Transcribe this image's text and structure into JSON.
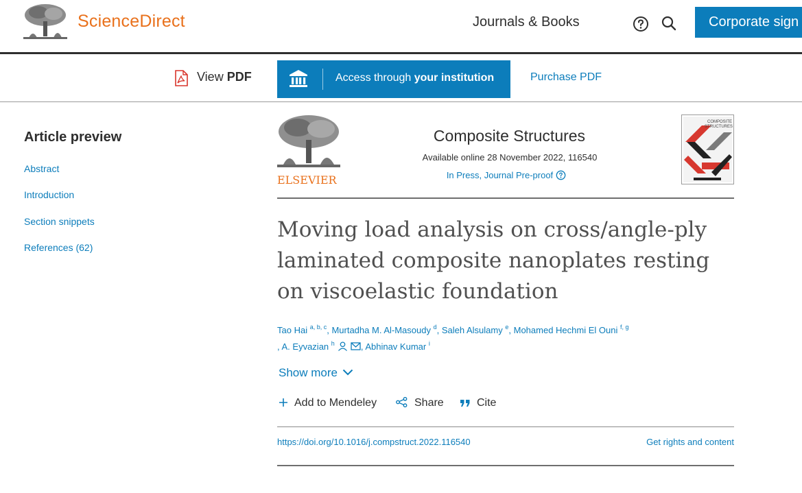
{
  "header": {
    "brand": "ScienceDirect",
    "nav_journals": "Journals & Books",
    "help_icon": "question-circle-icon",
    "search_icon": "search-icon",
    "corporate_button": "Corporate sign in",
    "brand_color": "#e9711c",
    "accent_color": "#0c7dbb"
  },
  "action_bar": {
    "view_pdf_prefix": "View",
    "view_pdf_bold": "PDF",
    "access_prefix": "Access through",
    "access_bold": "your institution",
    "purchase_pdf": "Purchase PDF"
  },
  "sidebar": {
    "title": "Article preview",
    "items": [
      {
        "label": "Abstract"
      },
      {
        "label": "Introduction"
      },
      {
        "label": "Section snippets"
      },
      {
        "label": "References (62)"
      }
    ]
  },
  "journal": {
    "publisher_logo_text": "ELSEVIER",
    "name": "Composite Structures",
    "available": "Available online 28 November 2022, 116540",
    "status": "In Press, Journal Pre-proof",
    "cover_text": "COMPOSITE STRUCTURES"
  },
  "article": {
    "title": "Moving load analysis on cross/angle-ply laminated composite nanoplates resting on viscoelastic foundation",
    "authors": [
      {
        "name": "Tao Hai",
        "sup": "a, b, c"
      },
      {
        "name": "Murtadha M. Al-Masoudy",
        "sup": "d"
      },
      {
        "name": "Saleh Alsulamy",
        "sup": "e"
      },
      {
        "name": "Mohamed Hechmi El Ouni",
        "sup": "f, g"
      },
      {
        "name": "A. Eyvazian",
        "sup": "h"
      },
      {
        "name": "Abhinav Kumar",
        "sup": "i"
      }
    ],
    "show_more": "Show more",
    "add_mendeley": "Add to Mendeley",
    "share": "Share",
    "cite": "Cite",
    "doi": "https://doi.org/10.1016/j.compstruct.2022.116540",
    "rights": "Get rights and content"
  }
}
